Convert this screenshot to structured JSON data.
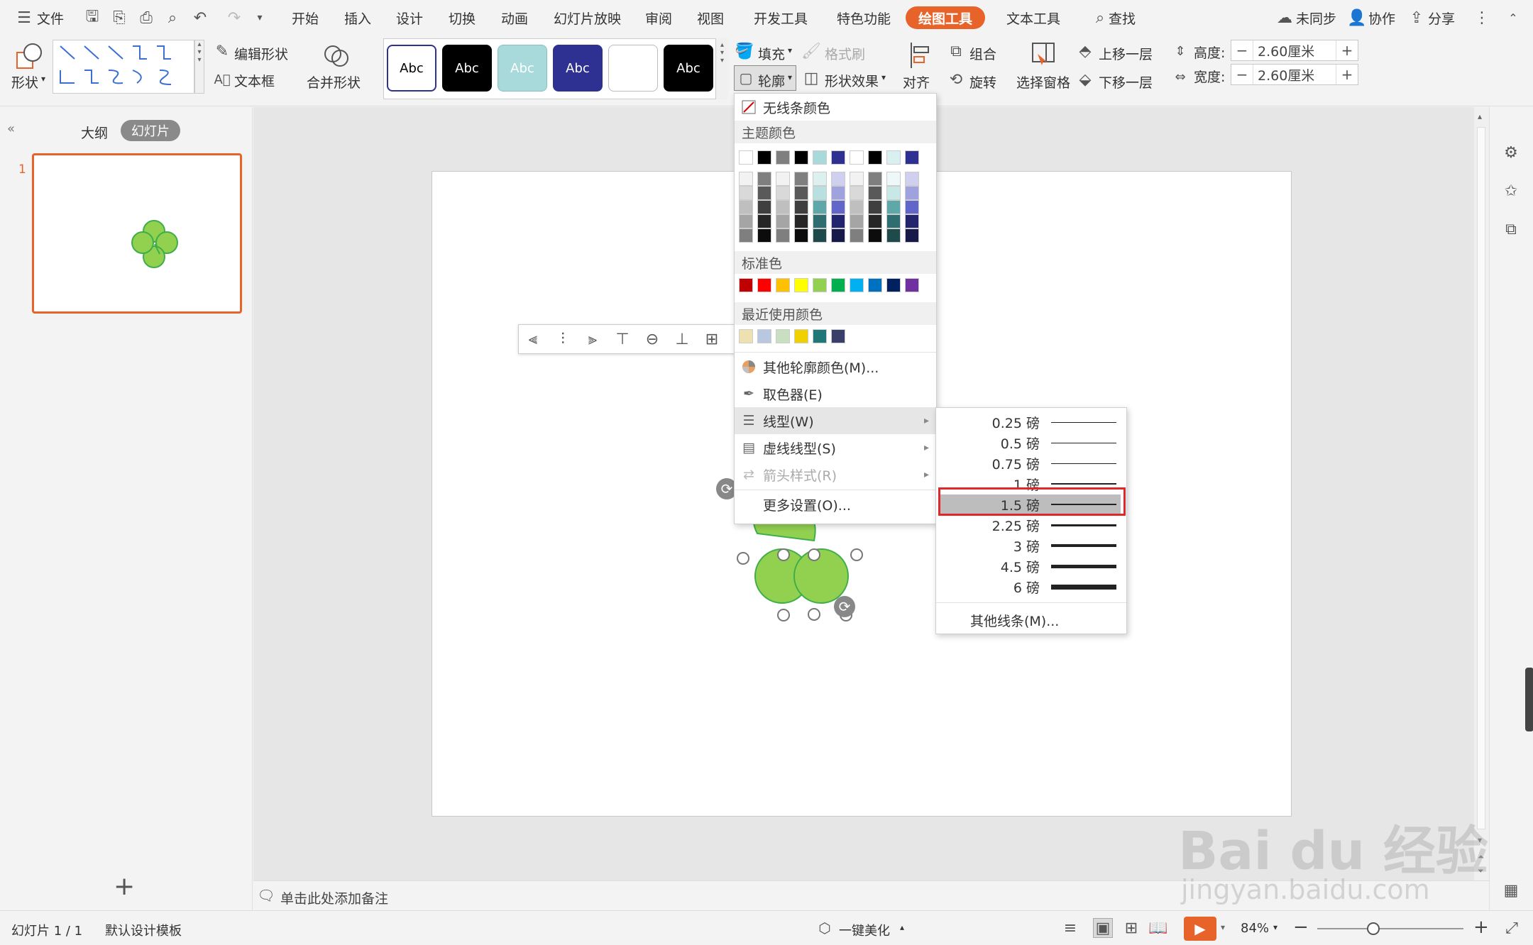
{
  "menubar": {
    "file": "文件",
    "tabs": [
      "开始",
      "插入",
      "设计",
      "切换",
      "动画",
      "幻灯片放映",
      "审阅",
      "视图",
      "开发工具",
      "特色功能"
    ],
    "active_tab": "绘图工具",
    "text_tools": "文本工具",
    "search": "查找",
    "sync": "未同步",
    "collab": "协作",
    "share": "分享"
  },
  "ribbon": {
    "shape": "形状",
    "edit_shape": "编辑形状",
    "textbox": "文本框",
    "merge_shape": "合并形状",
    "style_label": "Abc",
    "fill": "填充",
    "format_painter": "格式刷",
    "outline": "轮廓",
    "shape_effect": "形状效果",
    "align": "对齐",
    "group": "组合",
    "rotate": "旋转",
    "selection_pane": "选择窗格",
    "bring_forward": "上移一层",
    "send_backward": "下移一层",
    "height_label": "高度:",
    "height_value": "2.60厘米",
    "width_label": "宽度:",
    "width_value": "2.60厘米",
    "minus": "−",
    "plus": "+"
  },
  "left_panel": {
    "outline_tab": "大纲",
    "slides_tab": "幻灯片",
    "slide_number": "1",
    "add": "+"
  },
  "outline_menu": {
    "no_line": "无线条颜色",
    "theme_colors": "主题颜色",
    "standard_colors": "标准色",
    "recent_colors": "最近使用颜色",
    "more_colors": "其他轮廓颜色(M)...",
    "eyedropper": "取色器(E)",
    "line_type": "线型(W)",
    "dash_type": "虚线线型(S)",
    "arrow_style": "箭头样式(R)",
    "more_settings": "更多设置(O)...",
    "theme_row0": [
      "#ffffff",
      "#000000",
      "#7f7f7f",
      "#000000",
      "#a9dadb",
      "#2e3192",
      "#ffffff",
      "#000000",
      "#d9f0f0",
      "#2e3192"
    ],
    "standard": [
      "#c00000",
      "#ff0000",
      "#ffc000",
      "#ffff00",
      "#92d050",
      "#00b050",
      "#00b0f0",
      "#0070c0",
      "#002060",
      "#7030a0"
    ],
    "recent": [
      "#efe0b0",
      "#b8c8e0",
      "#c8dfc0",
      "#f0d000",
      "#1f7878",
      "#3a3f6a"
    ]
  },
  "weight_menu": {
    "items": [
      {
        "label": "0.25 磅",
        "w": 1
      },
      {
        "label": "0.5 磅",
        "w": 1
      },
      {
        "label": "0.75 磅",
        "w": 1
      },
      {
        "label": "1 磅",
        "w": 2
      },
      {
        "label": "1.5 磅",
        "w": 2
      },
      {
        "label": "2.25 磅",
        "w": 3
      },
      {
        "label": "3 磅",
        "w": 4
      },
      {
        "label": "4.5 磅",
        "w": 5
      },
      {
        "label": "6 磅",
        "w": 7
      }
    ],
    "selected_index": 4,
    "more": "其他线条(M)..."
  },
  "notes": {
    "placeholder": "单击此处添加备注"
  },
  "status": {
    "slide_info": "幻灯片 1 / 1",
    "template": "默认设计模板",
    "beautify": "一键美化",
    "zoom": "84%"
  },
  "watermark": {
    "brand": "Bai du 经验",
    "url": "jingyan.baidu.com"
  }
}
